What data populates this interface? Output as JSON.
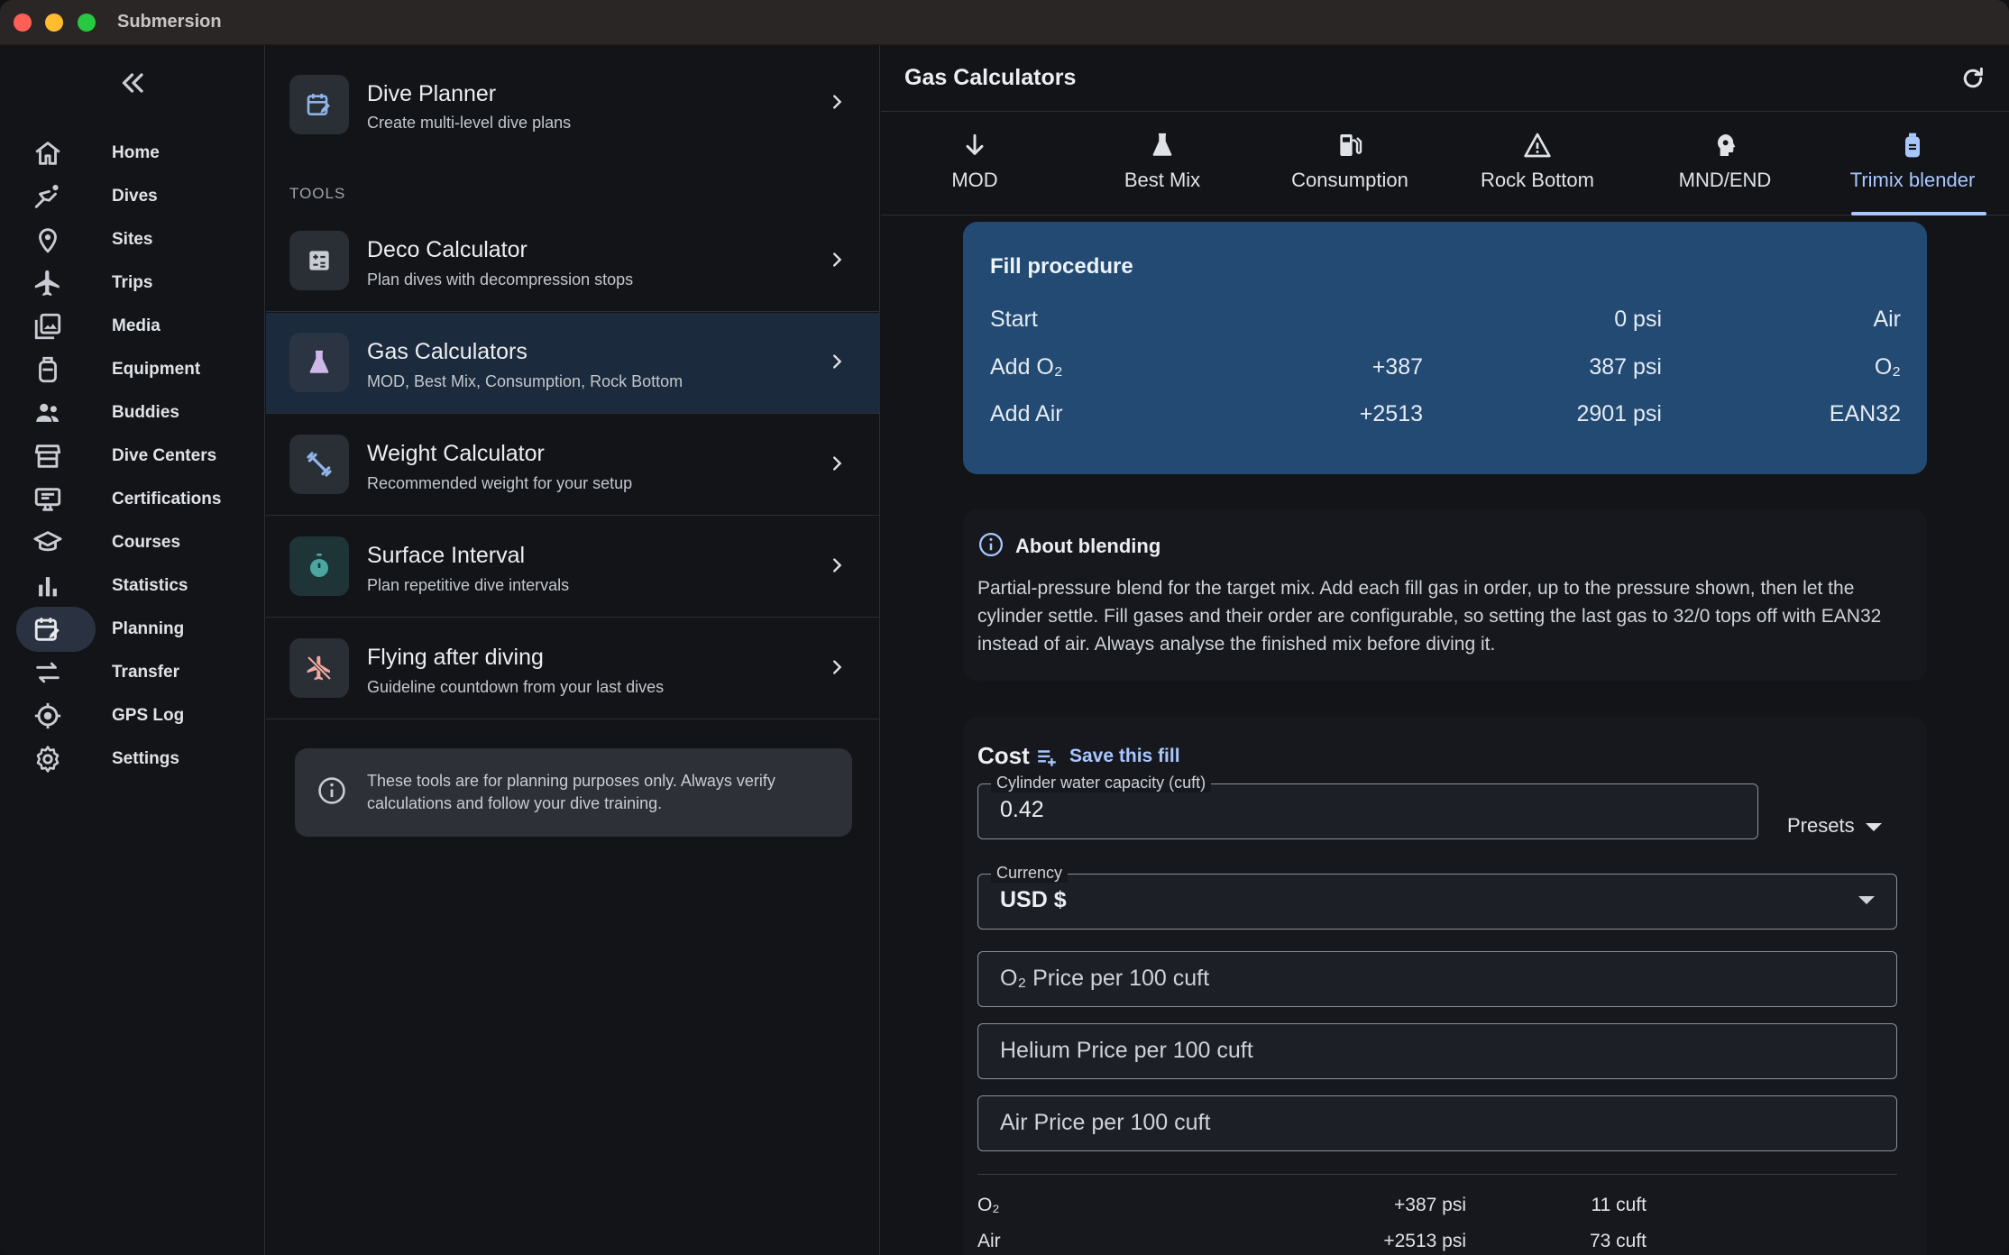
{
  "app": {
    "title": "Submersion"
  },
  "colors": {
    "accent": "#a9c7ff",
    "fill_card": "#234a72",
    "selected_row": "#1b2a3c",
    "close": "#ff5f57",
    "minimize": "#febc2e",
    "zoom": "#28c840"
  },
  "nav": {
    "collapse_icon": "double-chevron-left-icon",
    "items": [
      {
        "label": "Home",
        "icon": "home-icon"
      },
      {
        "label": "Dives",
        "icon": "diver-icon"
      },
      {
        "label": "Sites",
        "icon": "location-pin-icon"
      },
      {
        "label": "Trips",
        "icon": "airplane-icon"
      },
      {
        "label": "Media",
        "icon": "photo-library-icon"
      },
      {
        "label": "Equipment",
        "icon": "tank-icon"
      },
      {
        "label": "Buddies",
        "icon": "people-icon"
      },
      {
        "label": "Dive Centers",
        "icon": "storefront-icon"
      },
      {
        "label": "Certifications",
        "icon": "card-icon"
      },
      {
        "label": "Courses",
        "icon": "school-icon"
      },
      {
        "label": "Statistics",
        "icon": "bar-chart-icon"
      },
      {
        "label": "Planning",
        "icon": "calendar-edit-icon",
        "active": true
      },
      {
        "label": "Transfer",
        "icon": "swap-arrows-icon"
      },
      {
        "label": "GPS Log",
        "icon": "gps-icon"
      },
      {
        "label": "Settings",
        "icon": "gear-icon"
      }
    ]
  },
  "tools": {
    "top_item": {
      "title": "Dive Planner",
      "subtitle": "Create multi-level dive plans",
      "icon": "calendar-edit-icon"
    },
    "section_label": "TOOLS",
    "items": [
      {
        "title": "Deco Calculator",
        "subtitle": "Plan dives with decompression stops",
        "icon": "calculator-icon"
      },
      {
        "title": "Gas Calculators",
        "subtitle": "MOD, Best Mix, Consumption, Rock Bottom",
        "icon": "flask-icon",
        "selected": true
      },
      {
        "title": "Weight Calculator",
        "subtitle": "Recommended weight for your setup",
        "icon": "dumbbell-icon"
      },
      {
        "title": "Surface Interval",
        "subtitle": "Plan repetitive dive intervals",
        "icon": "timer-icon"
      },
      {
        "title": "Flying after diving",
        "subtitle": "Guideline countdown from your last dives",
        "icon": "airplane-off-icon"
      }
    ],
    "disclaimer": "These tools are for planning purposes only. Always verify calculations and follow your dive training."
  },
  "detail": {
    "title": "Gas Calculators",
    "refresh_icon": "refresh-icon",
    "tabs": [
      {
        "label": "MOD",
        "icon": "arrow-down-icon"
      },
      {
        "label": "Best Mix",
        "icon": "flask-icon"
      },
      {
        "label": "Consumption",
        "icon": "fuel-pump-icon"
      },
      {
        "label": "Rock Bottom",
        "icon": "warning-icon"
      },
      {
        "label": "MND/END",
        "icon": "head-gear-icon"
      },
      {
        "label": "Trimix blender",
        "icon": "cylinder-icon",
        "active": true
      }
    ],
    "fill_procedure": {
      "title": "Fill procedure",
      "rows": [
        {
          "step": "Start",
          "added": "",
          "pressure": "0 psi",
          "gas": "Air"
        },
        {
          "step": "Add O₂",
          "added": "+387",
          "pressure": "387 psi",
          "gas": "O₂"
        },
        {
          "step": "Add Air",
          "added": "+2513",
          "pressure": "2901 psi",
          "gas": "EAN32"
        }
      ]
    },
    "about": {
      "title": "About blending",
      "text": "Partial-pressure blend for the target mix. Add each fill gas in order, up to the pressure shown, then let the cylinder settle. Fill gases and their order are configurable, so setting the last gas to 32/0 tops off with EAN32 instead of air. Always analyse the finished mix before diving it."
    },
    "cost": {
      "title": "Cost",
      "save_label": "Save this fill",
      "cylinder_label": "Cylinder water capacity (cuft)",
      "cylinder_value": "0.42",
      "presets_label": "Presets",
      "currency_label": "Currency",
      "currency_value": "USD  $",
      "o2_price_placeholder": "O₂  Price per 100 cuft",
      "helium_price_placeholder": "Helium  Price per 100 cuft",
      "air_price_placeholder": "Air  Price per 100 cuft",
      "summary": [
        {
          "gas": "O₂",
          "pressure": "+387 psi",
          "volume": "11 cuft"
        },
        {
          "gas": "Air",
          "pressure": "+2513 psi",
          "volume": "73 cuft"
        }
      ]
    }
  }
}
